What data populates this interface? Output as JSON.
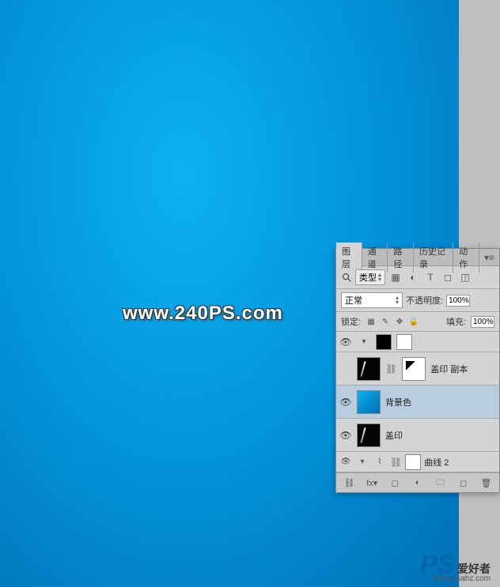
{
  "watermark": "www.240PS.com",
  "logo": {
    "text": "PS",
    "cn": "爱好者",
    "url": "www.psahz.com"
  },
  "panel": {
    "tabs": {
      "layers": "图层",
      "channels": "通道",
      "paths": "路径",
      "history": "历史记录",
      "actions": "动作"
    },
    "type_label": "类型",
    "blend_mode": "正常",
    "opacity_label": "不透明度:",
    "opacity_value": "100%",
    "lock_label": "锁定:",
    "fill_label": "填充:",
    "fill_value": "100%",
    "layers_list": [
      {
        "name": "盖印 副本",
        "visible": false,
        "type": "masked"
      },
      {
        "name": "背景色",
        "visible": true,
        "type": "blue",
        "selected": true
      },
      {
        "name": "盖印",
        "visible": true,
        "type": "black2"
      },
      {
        "name": "曲线 2",
        "visible": true,
        "type": "adjustment"
      }
    ]
  }
}
